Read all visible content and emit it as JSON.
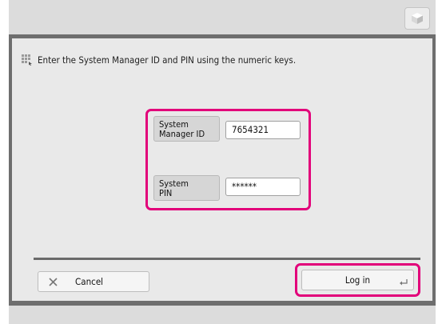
{
  "message": "Enter the System Manager ID and PIN using the numeric keys.",
  "fields": {
    "id_label_line1": "System",
    "id_label_line2": "Manager ID",
    "id_value": "7654321",
    "pin_label_line1": "System",
    "pin_label_line2": "PIN",
    "pin_value": "******"
  },
  "buttons": {
    "cancel": "Cancel",
    "login": "Log in"
  },
  "colors": {
    "highlight": "#e2007a",
    "frame": "#6e6e6e",
    "panel": "#e9e9e9"
  },
  "icons": {
    "top": "cube-icon",
    "message": "keypad-icon",
    "cancel": "close-icon",
    "login": "enter-icon"
  }
}
